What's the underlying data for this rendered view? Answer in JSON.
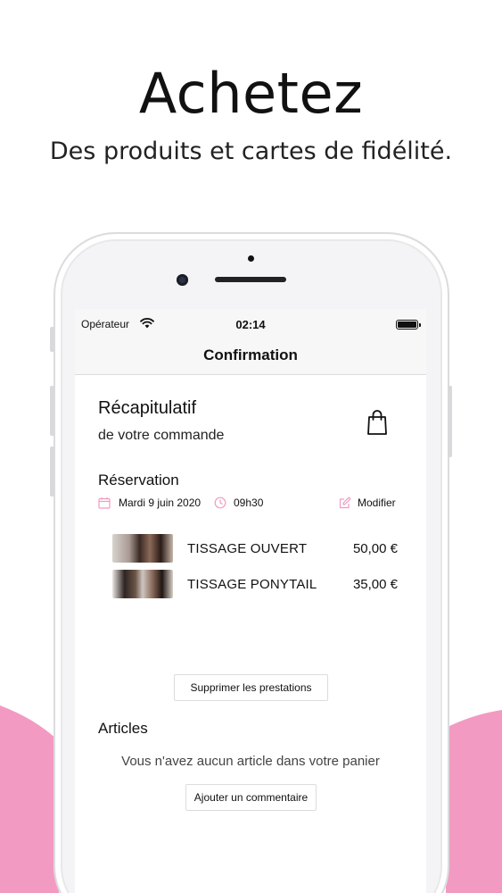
{
  "promo": {
    "headline": "Achetez",
    "subline": "Des produits et cartes de fidélité.",
    "accent_color": "#f39ac3"
  },
  "statusbar": {
    "carrier": "Opérateur",
    "time": "02:14"
  },
  "navbar": {
    "title": "Confirmation"
  },
  "summary": {
    "title": "Récapitulatif",
    "subtitle": "de votre commande",
    "icon": "shopping-bag-icon"
  },
  "reservation": {
    "title": "Réservation",
    "date": "Mardi 9 juin 2020",
    "time": "09h30",
    "edit_label": "Modifier",
    "services": [
      {
        "name": "TISSAGE OUVERT",
        "price": "50,00 €"
      },
      {
        "name": "TISSAGE PONYTAIL",
        "price": "35,00 €"
      }
    ],
    "remove_label": "Supprimer les prestations"
  },
  "articles": {
    "title": "Articles",
    "empty_text": "Vous n'avez aucun article dans votre panier",
    "comment_label": "Ajouter un commentaire"
  }
}
